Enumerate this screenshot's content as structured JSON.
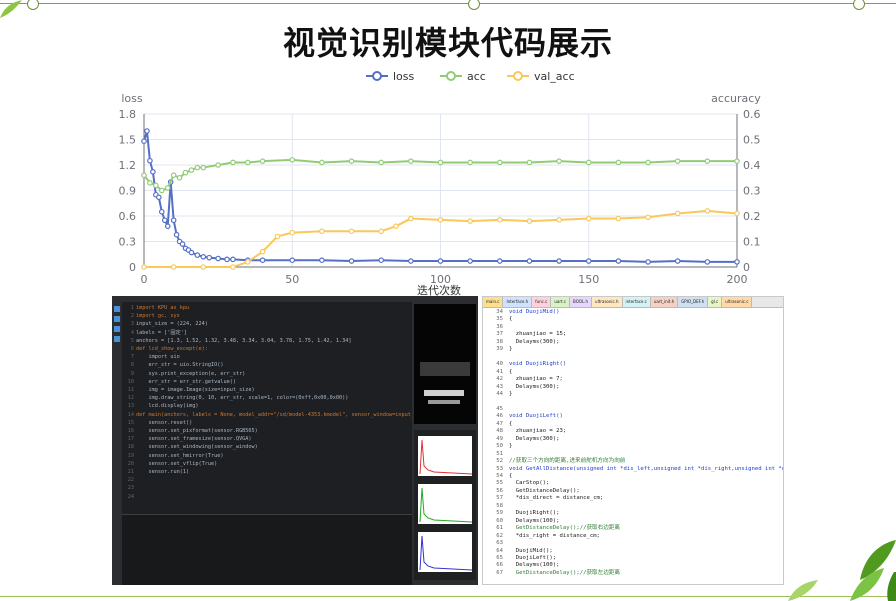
{
  "slide": {
    "title": "视觉识别模块代码展示",
    "accent": "#7aa63c"
  },
  "chart_data": {
    "type": "line",
    "title": "",
    "legend": [
      "loss",
      "acc",
      "val_acc"
    ],
    "legend_position": "top-center",
    "xlabel": "迭代次数",
    "ylabel_left": "loss",
    "ylabel_right": "accuracy",
    "xlim": [
      0,
      200
    ],
    "xticks": [
      0,
      50,
      100,
      150,
      200
    ],
    "ylim_left": [
      0,
      1.8
    ],
    "yticks_left": [
      "0",
      "0.3",
      "0.6",
      "0.9",
      "1.2",
      "1.5",
      "1.8"
    ],
    "ylim_right": [
      0,
      0.6
    ],
    "yticks_right": [
      "0",
      "0.1",
      "0.2",
      "0.3",
      "0.4",
      "0.5",
      "0.6"
    ],
    "grid": true,
    "series": [
      {
        "name": "loss",
        "axis": "left",
        "color": "#5470c6",
        "x": [
          0,
          1,
          2,
          3,
          4,
          5,
          6,
          7,
          8,
          9,
          10,
          11,
          12,
          13,
          14,
          15,
          16,
          18,
          20,
          22,
          25,
          28,
          30,
          35,
          40,
          50,
          60,
          70,
          80,
          90,
          100,
          110,
          120,
          130,
          140,
          150,
          160,
          170,
          180,
          190,
          200
        ],
        "y": [
          1.48,
          1.6,
          1.25,
          1.12,
          0.85,
          0.82,
          0.65,
          0.55,
          0.48,
          1.0,
          0.55,
          0.38,
          0.3,
          0.27,
          0.22,
          0.2,
          0.17,
          0.14,
          0.12,
          0.11,
          0.1,
          0.09,
          0.09,
          0.08,
          0.08,
          0.08,
          0.08,
          0.07,
          0.08,
          0.07,
          0.07,
          0.07,
          0.07,
          0.07,
          0.07,
          0.07,
          0.07,
          0.06,
          0.07,
          0.06,
          0.06
        ]
      },
      {
        "name": "acc",
        "axis": "right",
        "color": "#91cc75",
        "x": [
          0,
          2,
          4,
          6,
          8,
          10,
          12,
          14,
          16,
          18,
          20,
          25,
          30,
          35,
          40,
          50,
          60,
          70,
          80,
          90,
          100,
          110,
          120,
          130,
          140,
          150,
          160,
          170,
          180,
          190,
          200
        ],
        "y": [
          0.36,
          0.33,
          0.32,
          0.3,
          0.31,
          0.36,
          0.35,
          0.37,
          0.38,
          0.39,
          0.39,
          0.4,
          0.41,
          0.41,
          0.415,
          0.42,
          0.41,
          0.415,
          0.41,
          0.415,
          0.41,
          0.41,
          0.41,
          0.41,
          0.415,
          0.41,
          0.41,
          0.41,
          0.415,
          0.415,
          0.415
        ]
      },
      {
        "name": "val_acc",
        "axis": "right",
        "color": "#fac858",
        "x": [
          0,
          10,
          20,
          30,
          35,
          40,
          45,
          50,
          60,
          70,
          80,
          85,
          90,
          100,
          110,
          120,
          130,
          140,
          150,
          160,
          170,
          180,
          190,
          200
        ],
        "y": [
          0,
          0,
          0,
          0,
          0.02,
          0.06,
          0.12,
          0.135,
          0.14,
          0.14,
          0.14,
          0.16,
          0.19,
          0.185,
          0.18,
          0.185,
          0.18,
          0.185,
          0.19,
          0.19,
          0.195,
          0.21,
          0.22,
          0.21
        ]
      }
    ]
  },
  "screenshots": {
    "python": {
      "lines": [
        "import KPU as kpu",
        "import gc, sys",
        "",
        "input_size = (224, 224)",
        "labels = ['固定']",
        "anchors = [1.3, 1.52, 1.32, 3.48, 3.34, 3.04, 3.78, 1.75, 1.42, 1.34]",
        "",
        "def lcd_show_except(e):",
        "    import uio",
        "    err_str = uio.StringIO()",
        "    sys.print_exception(e, err_str)",
        "    err_str = err_str.getvalue()",
        "    img = image.Image(size=input_size)",
        "    img.draw_string(0, 10, err_str, scale=1, color=(0xff,0x00,0x00))",
        "    lcd.display(img)",
        "",
        "def main(anchors, labels = None, model_addr=\"/sd/model-4353.kmodel\", sensor_window=input_size,",
        "    sensor.reset()",
        "    sensor.set_pixformat(sensor.RGB565)",
        "    sensor.set_framesize(sensor.QVGA)",
        "    sensor.set_windowing(sensor_window)",
        "    sensor.set_hmirror(True)",
        "    sensor.set_vflip(True)",
        "    sensor.run(1)"
      ]
    },
    "keil": {
      "tabs": [
        "main.c",
        "Interface.h",
        "func.c",
        "uart.c",
        "BOOL.h",
        "ultrasonic.h",
        "interface.c",
        "uart_init.h",
        "GPIO_DEF.h",
        "gl.c",
        "ultrasonic.c"
      ],
      "lines": [
        {
          "n": "34",
          "t": "void DuojiMid()"
        },
        {
          "n": "35",
          "t": "{"
        },
        {
          "n": "36",
          "t": ""
        },
        {
          "n": "37",
          "t": "  zhuanjiao = 15;"
        },
        {
          "n": "38",
          "t": "  Delayms(300);"
        },
        {
          "n": "39",
          "t": "}"
        },
        {
          "n": "",
          "t": ""
        },
        {
          "n": "40",
          "t": "void DuojiRight()"
        },
        {
          "n": "41",
          "t": "{"
        },
        {
          "n": "42",
          "t": "  zhuanjiao = 7;"
        },
        {
          "n": "43",
          "t": "  Delayms(300);"
        },
        {
          "n": "44",
          "t": "}"
        },
        {
          "n": "",
          "t": ""
        },
        {
          "n": "45",
          "t": ""
        },
        {
          "n": "46",
          "t": "void DuojiLeft()"
        },
        {
          "n": "47",
          "t": "{"
        },
        {
          "n": "48",
          "t": "  zhuanjiao = 23;"
        },
        {
          "n": "49",
          "t": "  Delayms(300);"
        },
        {
          "n": "50",
          "t": "}"
        },
        {
          "n": "51",
          "t": ""
        },
        {
          "n": "52",
          "t": "//获取三个方向的距离,进来前舵机方向为向前"
        },
        {
          "n": "53",
          "t": "void GetAllDistance(unsigned int *dis_left,unsigned int *dis_right,unsigned int *dis_direct)"
        },
        {
          "n": "54",
          "t": "{"
        },
        {
          "n": "55",
          "t": "  CarStop();"
        },
        {
          "n": "56",
          "t": "  GetDistanceDelay();"
        },
        {
          "n": "57",
          "t": "  *dis_direct = distance_cm;"
        },
        {
          "n": "58",
          "t": ""
        },
        {
          "n": "59",
          "t": "  DuojiRight();"
        },
        {
          "n": "60",
          "t": "  Delayms(100);"
        },
        {
          "n": "61",
          "t": "  GetDistanceDelay();//获取右边距离"
        },
        {
          "n": "62",
          "t": "  *dis_right = distance_cm;"
        },
        {
          "n": "63",
          "t": ""
        },
        {
          "n": "64",
          "t": "  DuojiMid();"
        },
        {
          "n": "65",
          "t": "  DuojiLeft();"
        },
        {
          "n": "66",
          "t": "  Delayms(100);"
        },
        {
          "n": "67",
          "t": "  GetDistanceDelay();//获取左边距离"
        }
      ]
    }
  }
}
